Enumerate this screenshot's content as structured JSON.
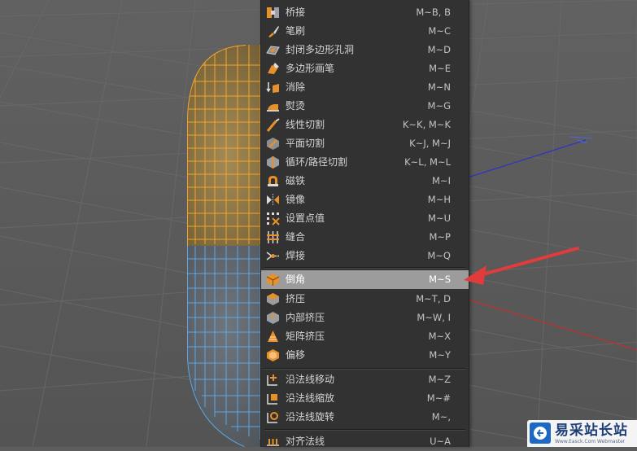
{
  "menu": {
    "items": [
      {
        "label": "桥接",
        "shortcut": "M~B, B",
        "icon": "bridge-icon"
      },
      {
        "label": "笔刷",
        "shortcut": "M~C",
        "icon": "brush-icon"
      },
      {
        "label": "封闭多边形孔洞",
        "shortcut": "M~D",
        "icon": "close-polygon-hole-icon"
      },
      {
        "label": "多边形画笔",
        "shortcut": "M~E",
        "icon": "polygon-pen-icon"
      },
      {
        "label": "消除",
        "shortcut": "M~N",
        "icon": "dissolve-icon"
      },
      {
        "label": "熨烫",
        "shortcut": "M~G",
        "icon": "iron-icon"
      },
      {
        "label": "线性切割",
        "shortcut": "K~K, M~K",
        "icon": "line-cut-icon"
      },
      {
        "label": "平面切割",
        "shortcut": "K~J, M~J",
        "icon": "plane-cut-icon"
      },
      {
        "label": "循环/路径切割",
        "shortcut": "K~L, M~L",
        "icon": "loop-path-cut-icon"
      },
      {
        "label": "磁铁",
        "shortcut": "M~I",
        "icon": "magnet-icon"
      },
      {
        "label": "镜像",
        "shortcut": "M~H",
        "icon": "mirror-icon"
      },
      {
        "label": "设置点值",
        "shortcut": "M~U",
        "icon": "set-point-value-icon"
      },
      {
        "label": "缝合",
        "shortcut": "M~P",
        "icon": "stitch-icon"
      },
      {
        "label": "焊接",
        "shortcut": "M~Q",
        "icon": "weld-icon"
      },
      {
        "label": "倒角",
        "shortcut": "M~S",
        "icon": "bevel-icon"
      },
      {
        "label": "挤压",
        "shortcut": "M~T, D",
        "icon": "extrude-icon"
      },
      {
        "label": "内部挤压",
        "shortcut": "M~W, I",
        "icon": "extrude-inner-icon"
      },
      {
        "label": "矩阵挤压",
        "shortcut": "M~X",
        "icon": "matrix-extrude-icon"
      },
      {
        "label": "偏移",
        "shortcut": "M~Y",
        "icon": "offset-icon"
      },
      {
        "label": "沿法线移动",
        "shortcut": "M~Z",
        "icon": "normal-move-icon"
      },
      {
        "label": "沿法线缩放",
        "shortcut": "M~#",
        "icon": "normal-scale-icon"
      },
      {
        "label": "沿法线旋转",
        "shortcut": "M~,",
        "icon": "normal-rotate-icon"
      },
      {
        "label": "对齐法线",
        "shortcut": "U~A",
        "icon": "align-normals-icon"
      }
    ],
    "highlighted": "倒角"
  },
  "watermark": {
    "text": "易采站长站",
    "url": "Www.Easck.Com  Webmaster"
  }
}
